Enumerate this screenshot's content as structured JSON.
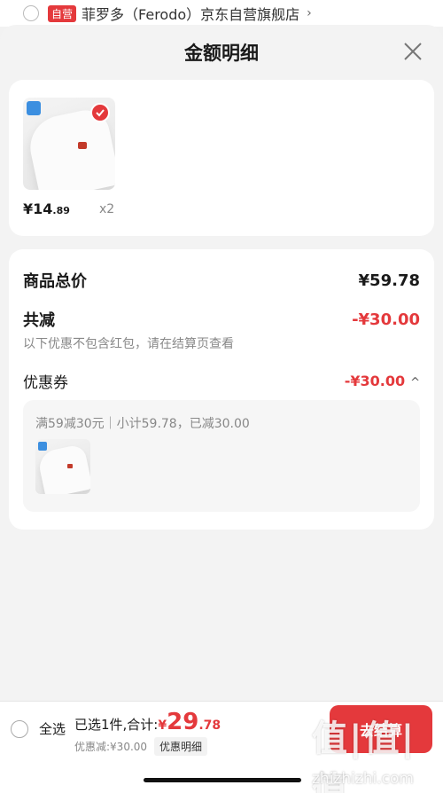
{
  "top_strip": {
    "badge": "自营",
    "shop_name": "菲罗多（Ferodo）京东自营旗舰店",
    "chevron": "›"
  },
  "sheet": {
    "title": "金额明细"
  },
  "product": {
    "price_main": "¥14",
    "price_dec": ".89",
    "qty": "x2"
  },
  "summary_card": {
    "total_label": "商品总价",
    "total_value": "¥59.78",
    "reduce_label": "共减",
    "reduce_value": "-¥30.00",
    "note": "以下优惠不包含红包，请在结算页查看",
    "coupon_label": "优惠券",
    "coupon_value": "-¥30.00",
    "coupon_caret": "^",
    "coupon_detail": "满59减30元｜小计59.78，已减30.00"
  },
  "bottom_bar": {
    "select_all": "全选",
    "summary_label": "已选1件,合计:",
    "yen": "¥",
    "total_int": "29",
    "total_dec": ".78",
    "discount_text": "优惠减:¥30.00",
    "detail_button": "优惠明细",
    "checkout": "去结算"
  },
  "watermark": {
    "big": "值|值|值",
    "small": "zhizhizhi.com"
  },
  "colors": {
    "accent": "#e4393c",
    "background": "#f3f3f3"
  }
}
